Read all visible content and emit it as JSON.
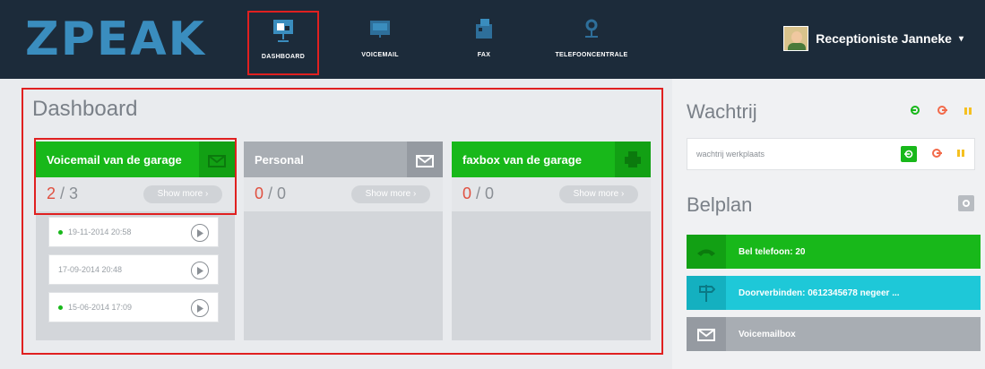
{
  "app": {
    "logo": "ZPEAK"
  },
  "nav": [
    {
      "label": "DASHBOARD",
      "icon": "presentation-icon",
      "active": true
    },
    {
      "label": "VOICEMAIL",
      "icon": "voicemail-icon",
      "active": false
    },
    {
      "label": "FAX",
      "icon": "fax-icon",
      "active": false
    },
    {
      "label": "TELEFOONCENTRALE",
      "icon": "gear-network-icon",
      "active": false
    }
  ],
  "user": {
    "name": "Receptioniste Janneke",
    "caret": "▾"
  },
  "dashboard": {
    "title": "Dashboard",
    "cards": [
      {
        "title": "Voicemail van de garage",
        "new": "2",
        "total": "3",
        "show_more": "Show more  ›",
        "color": "#18b81a"
      },
      {
        "title": "Personal",
        "new": "0",
        "total": "0",
        "show_more": "Show more  ›",
        "color": "#a8adb3"
      },
      {
        "title": "faxbox van de garage",
        "new": "0",
        "total": "0",
        "show_more": "Show more  ›",
        "color": "#18b81a"
      }
    ],
    "voicemails": [
      {
        "date": "19-11-2014 20:58",
        "unread": true
      },
      {
        "date": "17-09-2014 20:48",
        "unread": false
      },
      {
        "date": "15-06-2014 17:09",
        "unread": true
      }
    ]
  },
  "wachtrij": {
    "title": "Wachtrij",
    "queue_name": "wachtrij werkplaats"
  },
  "belplan": {
    "title": "Belplan",
    "items": [
      {
        "label": "Bel telefoon: 20",
        "color": "#18b81a",
        "icon": "phone-icon"
      },
      {
        "label": "Doorverbinden: 0612345678  negeer ...",
        "color": "#1ec8d8",
        "icon": "signpost-icon"
      },
      {
        "label": "Voicemailbox",
        "color": "#a8adb3",
        "icon": "mail-icon"
      }
    ]
  },
  "colors": {
    "accent_green": "#18b81a",
    "highlight_red": "#e02020",
    "navy": "#1c2b3a",
    "cyan": "#1ec8d8"
  }
}
